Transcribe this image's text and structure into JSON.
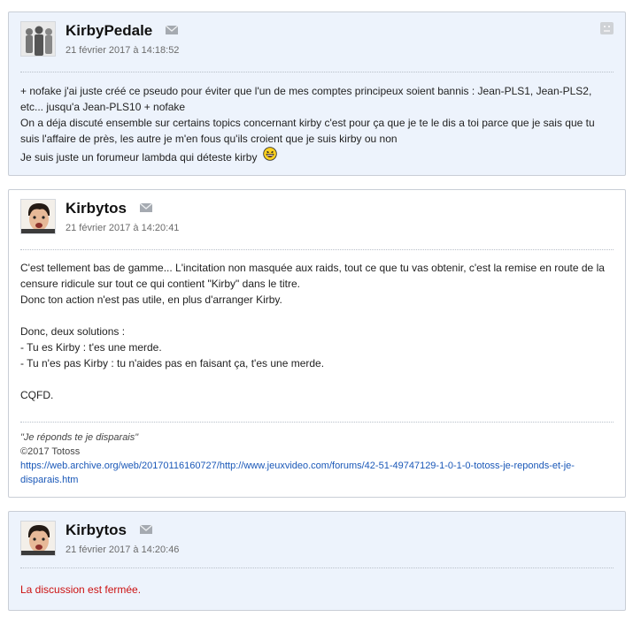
{
  "posts": [
    {
      "author": "KirbyPedale",
      "date": "21 février 2017 à 14:18:52",
      "avatar_icon": "silhouettes-avatar",
      "lines": [
        "+ nofake j'ai juste créé ce pseudo pour éviter que l'un de mes comptes principeux soient bannis : Jean-PLS1, Jean-PLS2,",
        "etc... jusqu'a Jean-PLS10 + nofake",
        "On a déja discuté ensemble sur certains topics concernant kirby c'est pour ça que je te le dis a toi parce que je sais que tu",
        "suis l'affaire de près, les autre je m'en fous qu'ils croient que je suis kirby ou non",
        "Je suis juste un forumeur lambda qui déteste kirby"
      ],
      "smiley_icon": "laughing-smiley-icon"
    },
    {
      "author": "Kirbytos",
      "date": "21 février 2017 à 14:20:41",
      "avatar_icon": "face-avatar",
      "lines": [
        "C'est tellement bas de gamme... L'incitation non masquée aux raids, tout ce que tu vas obtenir, c'est la remise en route de la",
        "censure ridicule sur tout ce qui contient \"Kirby\" dans le titre.",
        "Donc ton action n'est pas utile, en plus d'arranger Kirby.",
        "",
        "Donc, deux solutions :",
        "- Tu es Kirby : t'es une merde.",
        "- Tu n'es pas Kirby : tu n'aides pas en faisant ça, t'es une merde.",
        "",
        "CQFD."
      ],
      "signature": {
        "quote": "\"Je réponds te je disparais\"",
        "copyright": "©2017 Totoss",
        "link_line1": "https://web.archive.org/web/20170116160727/http://www.jeuxvideo.com/forums/42-51-49747129-1-0-1-0-totoss-je-reponds-et-je-",
        "link_line2": "disparais.htm"
      }
    },
    {
      "author": "Kirbytos",
      "date": "21 février 2017 à 14:20:46",
      "avatar_icon": "face-avatar",
      "message": "La discussion est fermée."
    }
  ],
  "colors": {
    "alt_post_bg": "#edf3fc",
    "link": "#1a58b8",
    "closed_text": "#cc1111"
  }
}
